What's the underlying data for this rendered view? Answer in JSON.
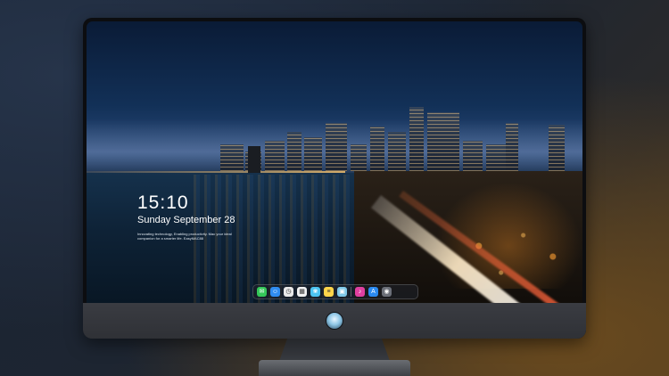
{
  "lock_screen": {
    "time": "15:10",
    "date": "Sunday September 28",
    "tagline": "Innovating technology, Enabling productivity. Mac your ideal companion for a smarter life. EasyMAC88"
  },
  "dock": {
    "items": [
      {
        "name": "messages-icon",
        "color": "#34c759",
        "glyph": "✉"
      },
      {
        "name": "finder-icon",
        "color": "#2f8cf0",
        "glyph": "☺"
      },
      {
        "name": "clock-icon",
        "color": "#e9e9e9",
        "glyph": "◷"
      },
      {
        "name": "calendar-icon",
        "color": "#f2f2f2",
        "glyph": "▦"
      },
      {
        "name": "photos-icon",
        "color": "#4cc3f0",
        "glyph": "❀"
      },
      {
        "name": "notes-icon",
        "color": "#ffd54a",
        "glyph": "≡"
      },
      {
        "name": "preview-icon",
        "color": "#7ec8e8",
        "glyph": "▣"
      },
      {
        "name": "music-icon",
        "color": "#e040a0",
        "glyph": "♪"
      },
      {
        "name": "app-store-icon",
        "color": "#2b8af0",
        "glyph": "A"
      },
      {
        "name": "camera-icon",
        "color": "#6b6f78",
        "glyph": "◉"
      }
    ]
  },
  "colors": {
    "bezel": "#0c0d10",
    "chin": "#34363b",
    "accent_glow": "#6a4a1e"
  }
}
